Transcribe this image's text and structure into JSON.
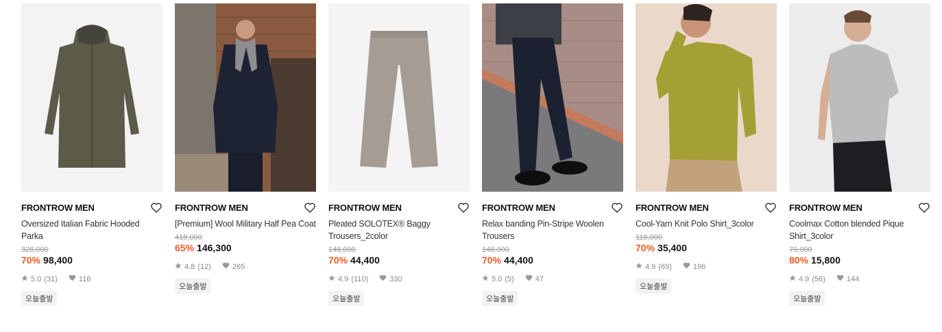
{
  "products": [
    {
      "brand": "FRONTROW MEN",
      "name": "Oversized Italian Fabric Hooded Parka",
      "original_price": "328,000",
      "discount": "70%",
      "price": "98,400",
      "rating": "5.0",
      "review_count": "(31)",
      "likes": "116",
      "badge": "오늘출발",
      "icons": {
        "like": "heart-outline-icon",
        "star": "star-icon",
        "likes": "heart-filled-icon"
      }
    },
    {
      "brand": "FRONTROW MEN",
      "name": "[Premium] Wool Military Half Pea Coat",
      "original_price": "418,000",
      "discount": "65%",
      "price": "146,300",
      "rating": "4.8",
      "review_count": "(12)",
      "likes": "265",
      "badge": "오늘출발"
    },
    {
      "brand": "FRONTROW MEN",
      "name": "Pleated SOLOTEX® Baggy Trousers_2color",
      "original_price": "148,000",
      "discount": "70%",
      "price": "44,400",
      "rating": "4.9",
      "review_count": "(110)",
      "likes": "330",
      "badge": "오늘출발"
    },
    {
      "brand": "FRONTROW MEN",
      "name": "Relax banding Pin-Stripe Woolen Trousers",
      "original_price": "148,000",
      "discount": "70%",
      "price": "44,400",
      "rating": "5.0",
      "review_count": "(5)",
      "likes": "47",
      "badge": "오늘출발"
    },
    {
      "brand": "FRONTROW MEN",
      "name": "Cool-Yarn Knit Polo Shirt_3color",
      "original_price": "118,000",
      "discount": "70%",
      "price": "35,400",
      "rating": "4.9",
      "review_count": "(69)",
      "likes": "196",
      "badge": "오늘출발"
    },
    {
      "brand": "FRONTROW MEN",
      "name": "Coolmax Cotton blended Pique Shirt_3color",
      "original_price": "79,000",
      "discount": "80%",
      "price": "15,800",
      "rating": "4.9",
      "review_count": "(56)",
      "likes": "144",
      "badge": "오늘출발"
    }
  ],
  "colors": {
    "discount": "#f05a22",
    "muted": "#888888",
    "badge_bg": "#f2f2f2"
  }
}
